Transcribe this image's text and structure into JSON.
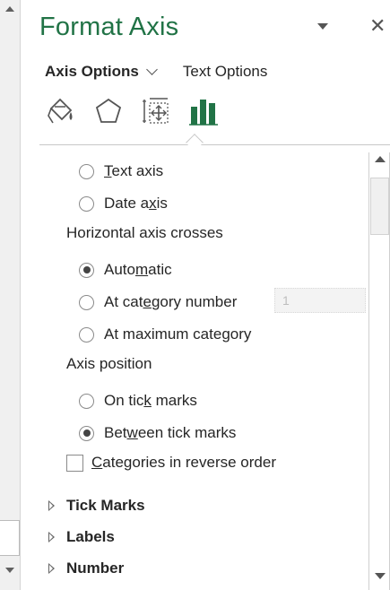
{
  "pane": {
    "title": "Format Axis",
    "tabs": {
      "axis_options": "Axis Options",
      "text_options": "Text Options"
    },
    "icons": [
      "fill-line-icon",
      "effects-icon",
      "size-properties-icon",
      "axis-options-icon"
    ]
  },
  "axis_type": {
    "options": [
      {
        "label": "Text axis",
        "selected": false
      },
      {
        "label": "Date axis",
        "selected": false
      }
    ]
  },
  "horizontal_axis_crosses": {
    "label": "Horizontal axis crosses",
    "options": [
      {
        "label": "Automatic",
        "selected": true
      },
      {
        "label": "At category number",
        "selected": false
      },
      {
        "label": "At maximum category",
        "selected": false
      }
    ],
    "category_number_value": "1"
  },
  "axis_position": {
    "label": "Axis position",
    "options": [
      {
        "label": "On tick marks",
        "selected": false
      },
      {
        "label": "Between tick marks",
        "selected": true
      }
    ]
  },
  "reverse_order": {
    "label": "Categories in reverse order",
    "checked": false
  },
  "sections": [
    "Tick Marks",
    "Labels",
    "Number"
  ],
  "colors": {
    "accent": "#217346",
    "text": "#262626"
  }
}
